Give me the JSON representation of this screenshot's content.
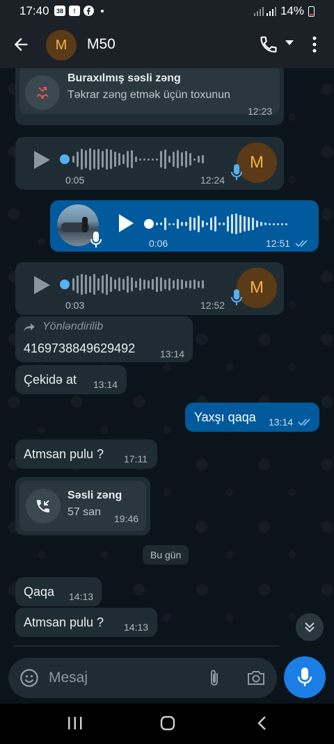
{
  "status": {
    "time": "17:40",
    "notif_badge": "38",
    "battery": "14%"
  },
  "header": {
    "contact_initial": "M",
    "contact_name": "M50"
  },
  "messages": {
    "missed_call": {
      "title": "Buraxılmış səsli zəng",
      "subtitle": "Təkrar zəng etmək üçün toxunun",
      "time": "12:23"
    },
    "voice1": {
      "duration": "0:05",
      "time": "12:24",
      "initial": "M"
    },
    "voice2": {
      "duration": "0:06",
      "time": "12:51"
    },
    "voice3": {
      "duration": "0:03",
      "time": "12:52",
      "initial": "M"
    },
    "forward": {
      "label": "Yönləndirilib",
      "text": "4169738849629492",
      "time": "13:14"
    },
    "m1": {
      "text": "Çekidə at",
      "time": "13:14"
    },
    "m2": {
      "text": "Yaxşı qaqa",
      "time": "13:14"
    },
    "m3": {
      "text": "Atmsan pulu ?",
      "time": "17:11"
    },
    "voice_call": {
      "title": "Səsli zəng",
      "duration": "57 san",
      "time": "19:46"
    },
    "day_chip": "Bu gün",
    "m4": {
      "text": "Qaqa",
      "time": "14:13"
    },
    "m5": {
      "text": "Atmsan pulu ?",
      "time": "14:13"
    }
  },
  "composer": {
    "placeholder": "Mesaj"
  },
  "colors": {
    "outgoing": "#005a9c",
    "incoming": "#202c33",
    "accent": "#1a7ee6",
    "missed": "#e0534f"
  }
}
